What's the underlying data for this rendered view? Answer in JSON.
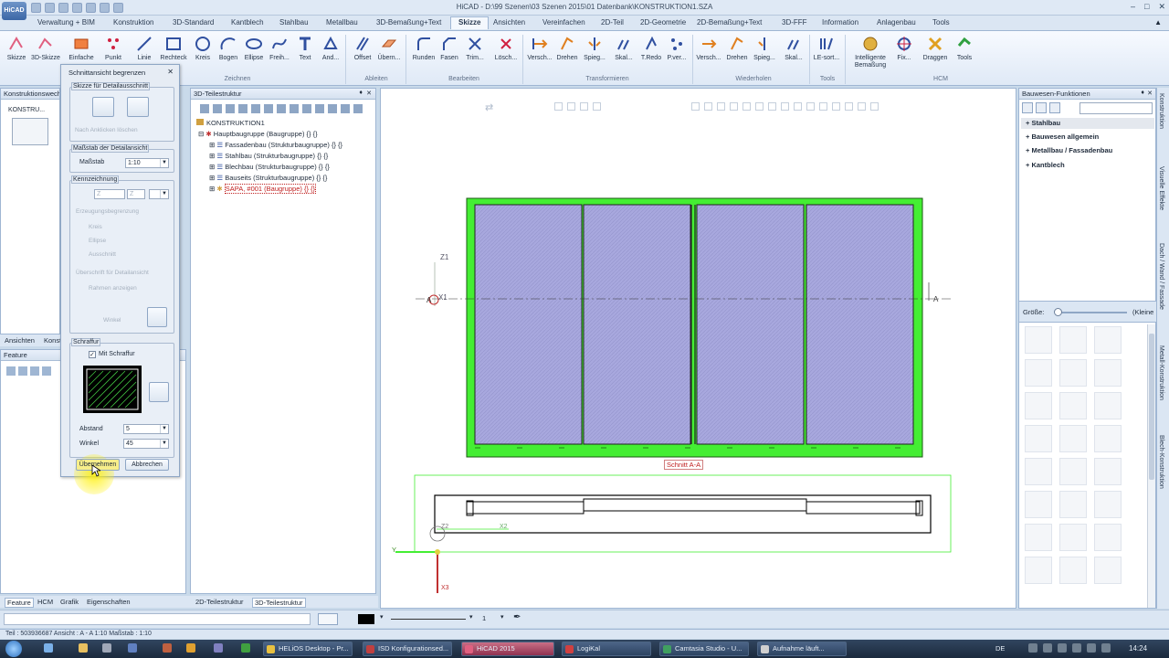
{
  "app": {
    "title": "HiCAD - D:\\99 Szenen\\03 Szenen 2015\\01 Datenbank\\KONSTRUKTION1.SZA",
    "logo": "HiCAD"
  },
  "menu": [
    {
      "label": "Verwaltung + BIM"
    },
    {
      "label": "Konstruktion"
    },
    {
      "label": "3D-Standard"
    },
    {
      "label": "Kantblech"
    },
    {
      "label": "Stahlbau"
    },
    {
      "label": "Metallbau"
    },
    {
      "label": "3D-Bemaßung+Text"
    },
    {
      "label": "Skizze",
      "active": true
    },
    {
      "label": "Ansichten"
    },
    {
      "label": "Vereinfachen"
    },
    {
      "label": "2D-Teil"
    },
    {
      "label": "2D-Geometrie"
    },
    {
      "label": "2D-Bemaßung+Text"
    },
    {
      "label": "3D-FFF"
    },
    {
      "label": "Information"
    },
    {
      "label": "Anlagenbau"
    },
    {
      "label": "Tools"
    }
  ],
  "ribbon": {
    "buttons": [
      {
        "label": "Skizze"
      },
      {
        "label": "3D-Skizze"
      },
      {
        "label": "Einfache"
      },
      {
        "label": "Punkt"
      },
      {
        "label": "Linie"
      },
      {
        "label": "Rechteck"
      },
      {
        "label": "Kreis"
      },
      {
        "label": "Bogen"
      },
      {
        "label": "Ellipse"
      },
      {
        "label": "Freih..."
      },
      {
        "label": "Text"
      },
      {
        "label": "And..."
      },
      {
        "label": "Offset"
      },
      {
        "label": "Übern..."
      },
      {
        "label": "Runden"
      },
      {
        "label": "Fasen"
      },
      {
        "label": "Trim..."
      },
      {
        "label": "Lösch..."
      },
      {
        "label": "Versch..."
      },
      {
        "label": "Drehen"
      },
      {
        "label": "Spieg..."
      },
      {
        "label": "Skal..."
      },
      {
        "label": "T.Redo"
      },
      {
        "label": "P.ver..."
      },
      {
        "label": "Versch..."
      },
      {
        "label": "Drehen"
      },
      {
        "label": "Spieg..."
      },
      {
        "label": "Skal..."
      },
      {
        "label": "LE-sort..."
      },
      {
        "label": "Intelligente Bemaßung"
      },
      {
        "label": "Fix..."
      },
      {
        "label": "Draggen"
      },
      {
        "label": "Tools"
      }
    ],
    "groups": [
      {
        "label": "Zeichnen"
      },
      {
        "label": "Ableiten"
      },
      {
        "label": "Bearbeiten"
      },
      {
        "label": "Transformieren"
      },
      {
        "label": "Wiederholen"
      },
      {
        "label": "Tools"
      },
      {
        "label": "HCM"
      }
    ]
  },
  "left_panel": {
    "header": "Konstruktionswech...",
    "thumb_label": "KONSTRU...",
    "tabs": [
      "Ansichten",
      "Konst..."
    ],
    "feature_header": "Feature"
  },
  "dialog": {
    "title": "Schnittansicht begrenzen",
    "sketch_group": "Skizze für Detailausschnitt",
    "sketch_check": "Nach Anklicken löschen",
    "scale_group": "Maßstab der Detailansicht",
    "scale_label": "Maßstab",
    "scale_value": "1:10",
    "label_group": "Kennzeichnung",
    "label_value": "Z",
    "label_value2": "Z",
    "frame_check": "Erzeugungsbegrenzung",
    "radio1": "Kreis",
    "radio2": "Ellipse",
    "radio3": "Ausschnitt",
    "sub_check": "Überschrift für Detailansicht",
    "frame_show": "Rahmen anzeigen",
    "winkel_small": "Winkel",
    "hatch_group": "Schraffur",
    "hatch_check": "Mit Schraffur",
    "abstand_label": "Abstand",
    "abstand_value": "5",
    "winkel_label": "Winkel",
    "winkel_value": "45",
    "ok": "Übernehmen",
    "cancel": "Abbrechen"
  },
  "tree": {
    "header": "3D-Teilestruktur",
    "rows": [
      {
        "label": "KONSTRUKTION1"
      },
      {
        "label": "Hauptbaugruppe (Baugruppe) {} {}"
      },
      {
        "label": "Fassadenbau (Strukturbaugruppe) {} {}"
      },
      {
        "label": "Stahlbau (Strukturbaugruppe) {} {}"
      },
      {
        "label": "Blechbau (Strukturbaugruppe) {} {}"
      },
      {
        "label": "Bauseits (Strukturbaugruppe) {} {}"
      },
      {
        "label": "SAPA, #001 (Baugruppe) {} {}"
      }
    ]
  },
  "canvas": {
    "section_label": "Schnitt A-A",
    "z1": "Z1",
    "x1": "X1",
    "a_left": "A",
    "a_right": "A",
    "y": "Y",
    "x2": "X2",
    "z2": "Z2",
    "x3": "X3",
    "accent": "#44ee33",
    "pane_fill": "#a5a5dd"
  },
  "right_panel": {
    "header": "Bauwesen-Funktionen",
    "items": [
      "Stahlbau",
      "Bauwesen allgemein",
      "Metallbau / Fassadenbau",
      "Kantblech"
    ],
    "size_label": "Größe:",
    "size_right": "(Kleine"
  },
  "side_tabs": [
    "Konstruktion",
    "Visuelle Effekte",
    "Dach / Wand / Fassade",
    "Metall-Konstruktion",
    "Blech-Konstruktion"
  ],
  "bottom_tabs": {
    "left": [
      "Feature",
      "HCM",
      "Grafik",
      "Eigenschaften"
    ],
    "middle": [
      "2D-Teilestruktur",
      "3D-Teilestruktur"
    ]
  },
  "toolbar2": {
    "page": "1"
  },
  "status": "Teil : 503936687   Ansicht : A - A 1:10   Maßstab : 1:10",
  "taskbar": {
    "apps": [
      {
        "label": "HELiOS Desktop - Pr..."
      },
      {
        "label": "ISD Konfigurationsed..."
      },
      {
        "label": "HiCAD 2015",
        "active": true
      },
      {
        "label": "LogiKal"
      },
      {
        "label": "Camtasia Studio - U..."
      },
      {
        "label": "Aufnahme läuft..."
      }
    ],
    "lang": "DE",
    "time": "14:24"
  }
}
